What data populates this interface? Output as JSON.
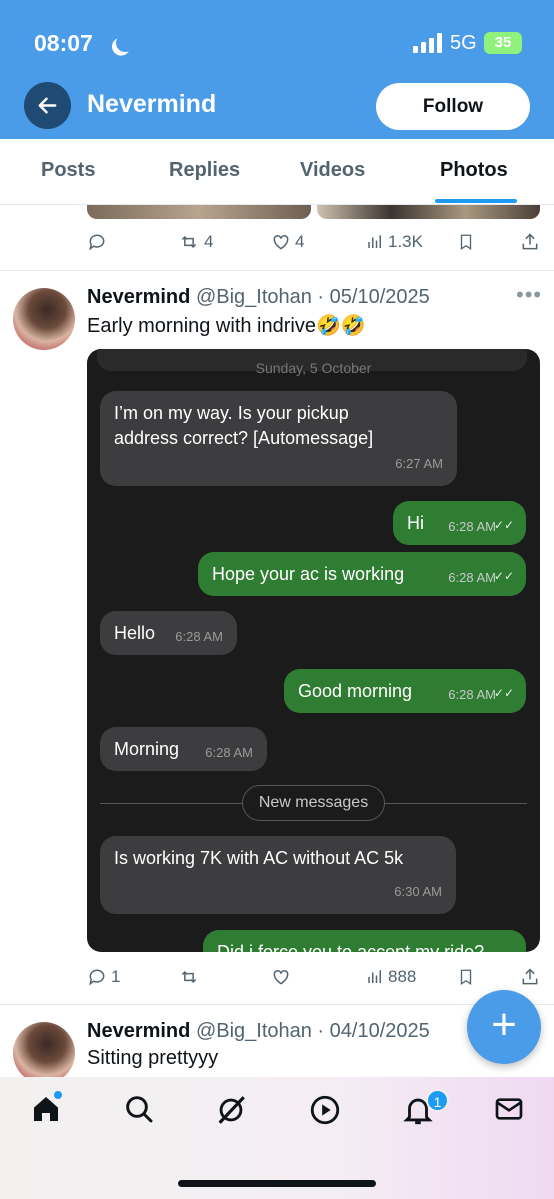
{
  "status_bar": {
    "time": "08:07",
    "network": "5G",
    "battery": "35"
  },
  "header": {
    "title": "Nevermind",
    "follow_label": "Follow"
  },
  "tabs": [
    {
      "label": "Posts",
      "active": false
    },
    {
      "label": "Replies",
      "active": false
    },
    {
      "label": "Videos",
      "active": false
    },
    {
      "label": "Photos",
      "active": true
    }
  ],
  "prev_tweet_actions": {
    "reposts": "4",
    "likes": "4",
    "views": "1.3K"
  },
  "tweet1": {
    "name": "Nevermind",
    "handle": "@Big_Itohan",
    "date": "05/10/2025",
    "text": "Early morning with indrive🤣🤣",
    "chat": {
      "date_label": "Sunday, 5 October",
      "messages": [
        {
          "dir": "in",
          "text": "I’m on my way. Is your pickup address correct? [Automessage]",
          "time": "6:27 AM"
        },
        {
          "dir": "out",
          "text": "Hi",
          "time": "6:28 AM"
        },
        {
          "dir": "out",
          "text": "Hope your ac is working",
          "time": "6:28 AM"
        },
        {
          "dir": "in",
          "text": "Hello",
          "time": "6:28 AM"
        },
        {
          "dir": "out",
          "text": "Good morning",
          "time": "6:28 AM"
        },
        {
          "dir": "in",
          "text": "Morning",
          "time": "6:28 AM"
        },
        {
          "dir": "in",
          "text": "Is working 7K with  AC without AC 5k",
          "time": "6:30 AM"
        },
        {
          "dir": "out",
          "text": "Did i force you to accept my ride?",
          "time": ""
        }
      ],
      "new_messages_label": "New messages"
    },
    "actions": {
      "replies": "1",
      "views": "888"
    }
  },
  "tweet2": {
    "name": "Nevermind",
    "handle": "@Big_Itohan",
    "date": "04/10/2025",
    "text": "Sitting prettyyy"
  },
  "notifications_badge": "1",
  "colors": {
    "header": "#4a9be8",
    "accent": "#1d9bf0",
    "sent_bubble": "#2e7d32",
    "received_bubble": "#3d3d3f"
  }
}
